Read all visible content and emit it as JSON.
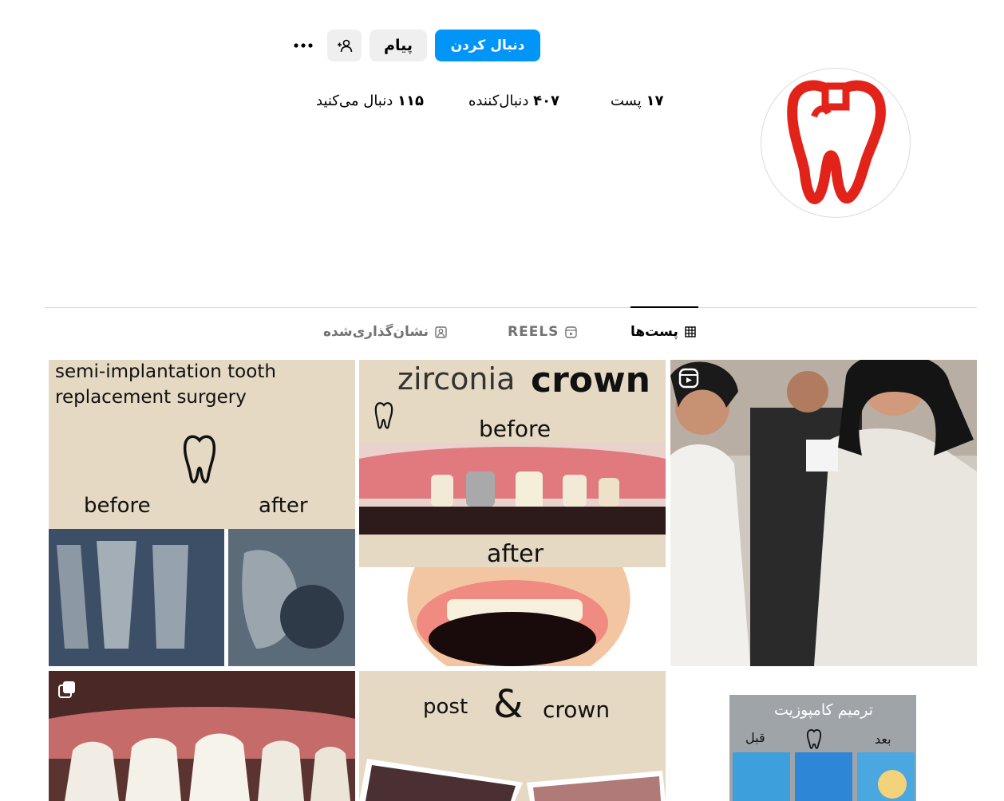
{
  "header": {
    "follow_label": "دنبال کردن",
    "message_label": "پیام",
    "suggest_icon": "person-plus-icon",
    "more_icon": "more-options-icon"
  },
  "stats": {
    "posts_count": "۱۷",
    "posts_label": "پست",
    "followers_count": "۴۰۷",
    "followers_label": "دنبال‌کننده",
    "following_count": "۱۱۵",
    "following_label": "دنبال می‌کنید"
  },
  "profile": {
    "avatar_icon": "tooth-logo",
    "brand_color": "#e2231a"
  },
  "tabs": [
    {
      "label": "پست‌ها",
      "icon": "grid-icon",
      "active": true
    },
    {
      "label": "REELS",
      "icon": "reels-icon",
      "active": false
    },
    {
      "label": "نشان‌گذاری‌شده",
      "icon": "tagged-icon",
      "active": false
    }
  ],
  "posts": [
    {
      "type": "reel",
      "badge_icon": "reel-badge-icon"
    },
    {
      "type": "image",
      "title_1": "zirconia",
      "title_2": "crown",
      "before": "before",
      "after": "after"
    },
    {
      "type": "image",
      "line_1": "semi-implantation tooth",
      "line_2": "replacement  surgery",
      "before": "before",
      "after": "after"
    },
    {
      "type": "image",
      "title": "ترمیم کامپوزیت",
      "before": "قبل",
      "after": "بعد"
    },
    {
      "type": "image",
      "word_1": "post",
      "amp": "&",
      "word_2": "crown"
    },
    {
      "type": "carousel",
      "badge_icon": "carousel-badge-icon"
    }
  ]
}
